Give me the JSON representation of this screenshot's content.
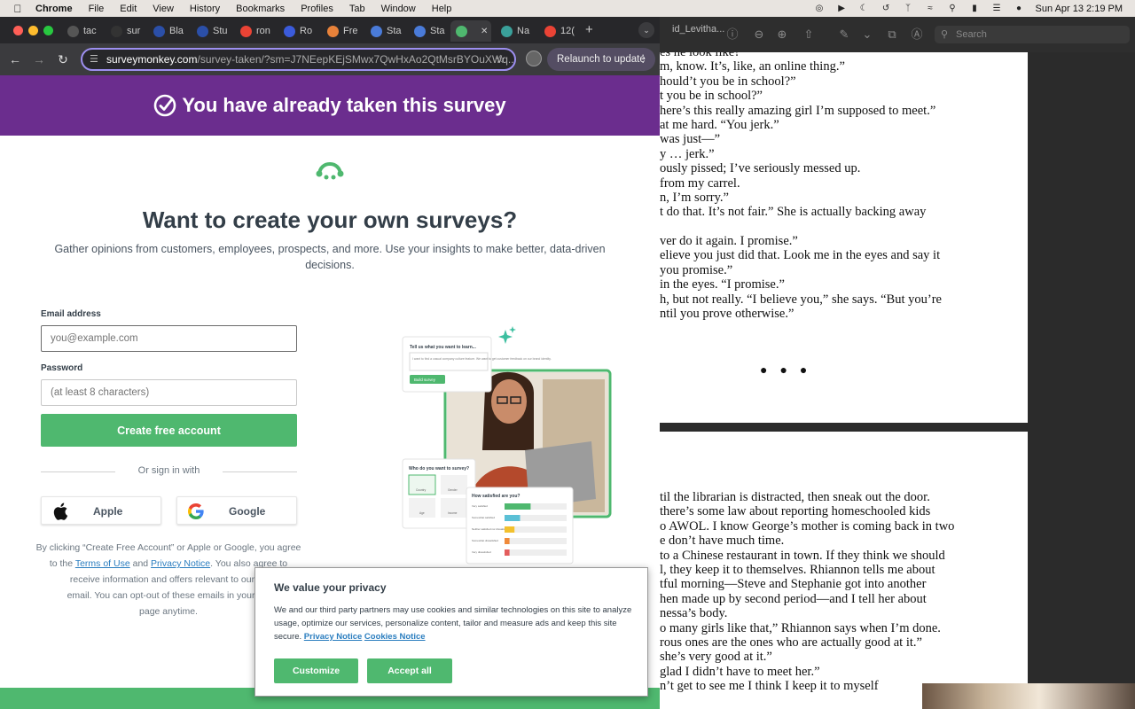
{
  "menubar": {
    "app": "Chrome",
    "items": [
      "File",
      "Edit",
      "View",
      "History",
      "Bookmarks",
      "Profiles",
      "Tab",
      "Window",
      "Help"
    ],
    "datetime": "Sun Apr 13  2:19 PM"
  },
  "chrome": {
    "tabs": [
      {
        "label": "tac",
        "fav_color": "#555"
      },
      {
        "label": "sur",
        "fav_color": "#333"
      },
      {
        "label": "Bla",
        "fav_color": "#2b4fa8"
      },
      {
        "label": "Stu",
        "fav_color": "#2b4fa8"
      },
      {
        "label": "ron",
        "fav_color": "#ea4335"
      },
      {
        "label": "Ro",
        "fav_color": "#3b5bdb"
      },
      {
        "label": "Fre",
        "fav_color": "#e8823a"
      },
      {
        "label": "Sta",
        "fav_color": "#4a7bd9"
      },
      {
        "label": "Sta",
        "fav_color": "#4a7bd9"
      },
      {
        "label": "",
        "fav_color": "#4fb86f"
      },
      {
        "label": "Na",
        "fav_color": "#3aa09a"
      },
      {
        "label": "12(",
        "fav_color": "#ea4335"
      }
    ],
    "url_domain": "surveymonkey.com",
    "url_path": "/survey-taken/?sm=J7NEepKEjSMwx7QwHxAo2QtMsrBYOuXWq...",
    "relaunch_label": "Relaunch to update"
  },
  "page": {
    "banner": "You have already taken this survey",
    "headline": "Want to create your own surveys?",
    "subtext": "Gather opinions from customers, employees, prospects, and more. Use your insights to make better, data-driven decisions.",
    "email_label": "Email address",
    "email_placeholder": "you@example.com",
    "password_label": "Password",
    "password_placeholder": "(at least 8 characters)",
    "create_button": "Create free account",
    "or_sign_in": "Or sign in with",
    "apple_label": "Apple",
    "google_label": "Google",
    "legal_1": "By clicking “Create Free Account” or Apple or Google, you agree to the ",
    "terms_link": "Terms of Use",
    "legal_and": " and ",
    "privacy_link": "Privacy Notice",
    "legal_2": ". You also agree to receive information and offers relevant to our se",
    "legal_3": "email. You can opt-out of these emails in your My",
    "legal_4": "page anytime.",
    "illustration": {
      "tell_us": "Tell us what you want to learn...",
      "tell_us_text": "I want to find a casual company culture feature. We want to get customer feedback on our brand identity.",
      "build_btn": "Build survey",
      "who": "Who do you want to survey?",
      "who_options": [
        "Country",
        "Gender",
        "Age",
        "Income"
      ],
      "satisfied": "How satisfied are you?",
      "satisfied_options": [
        "Very satisfied",
        "Somewhat satisfied",
        "Neither satisfied nor dissatisfied",
        "Somewhat dissatisfied",
        "Very dissatisfied"
      ],
      "satisfied_levels": [
        0.42,
        0.25,
        0.16,
        0.08,
        0.08
      ],
      "satisfied_colors": [
        "#4fb86f",
        "#5bc0d6",
        "#f2c12e",
        "#f08a3a",
        "#e35d5d"
      ]
    }
  },
  "cookie": {
    "title": "We value your privacy",
    "body": "We and our third party partners may use cookies and similar technologies on this site to analyze usage, optimize our services, personalize content, tailor and measure ads and keep this site secure.",
    "privacy_link": "Privacy Notice",
    "cookies_link": "Cookies Notice",
    "customize": "Customize",
    "accept": "Accept all"
  },
  "reader": {
    "title": "id_Levitha...",
    "search_placeholder": "Search",
    "page1_lines": [
      "es he look like?",
      "m, know. It’s, like, an online thing.”",
      "hould’t you be in school?”",
      "t you be in school?”",
      "here’s this really amazing girl I’m supposed to meet.”",
      "at me hard. “You jerk.”",
      "was just—”",
      "y … jerk.”",
      "ously pissed; I’ve seriously messed up.",
      "from my carrel.",
      "n, I’m sorry.”",
      "t do that. It’s not fair.” She is actually backing away",
      "",
      "ver do it again. I promise.”",
      "elieve you just did that. Look me in the eyes and say it",
      "you promise.”",
      "in the eyes. “I promise.”",
      "h, but not really. “I believe you,” she says. “But you’re",
      "ntil you prove otherwise.”"
    ],
    "page2_lines": [
      "til the librarian is distracted, then sneak out the door.",
      "there’s some law about reporting homeschooled kids",
      "o AWOL. I know George’s mother is coming back in two",
      "e don’t have much time.",
      "to a Chinese restaurant in town. If they think we should",
      "l, they keep it to themselves. Rhiannon tells me about",
      "tful morning—Steve and Stephanie got into another",
      "hen made up by second period—and I tell her about",
      "nessa’s body.",
      "o many girls like that,” Rhiannon says when I’m done.",
      "rous ones are the ones who are actually good at it.”",
      "she’s very good at it.”",
      "glad I didn’t have to meet her.”",
      "n’t get to see me I think I keep it to myself"
    ]
  }
}
